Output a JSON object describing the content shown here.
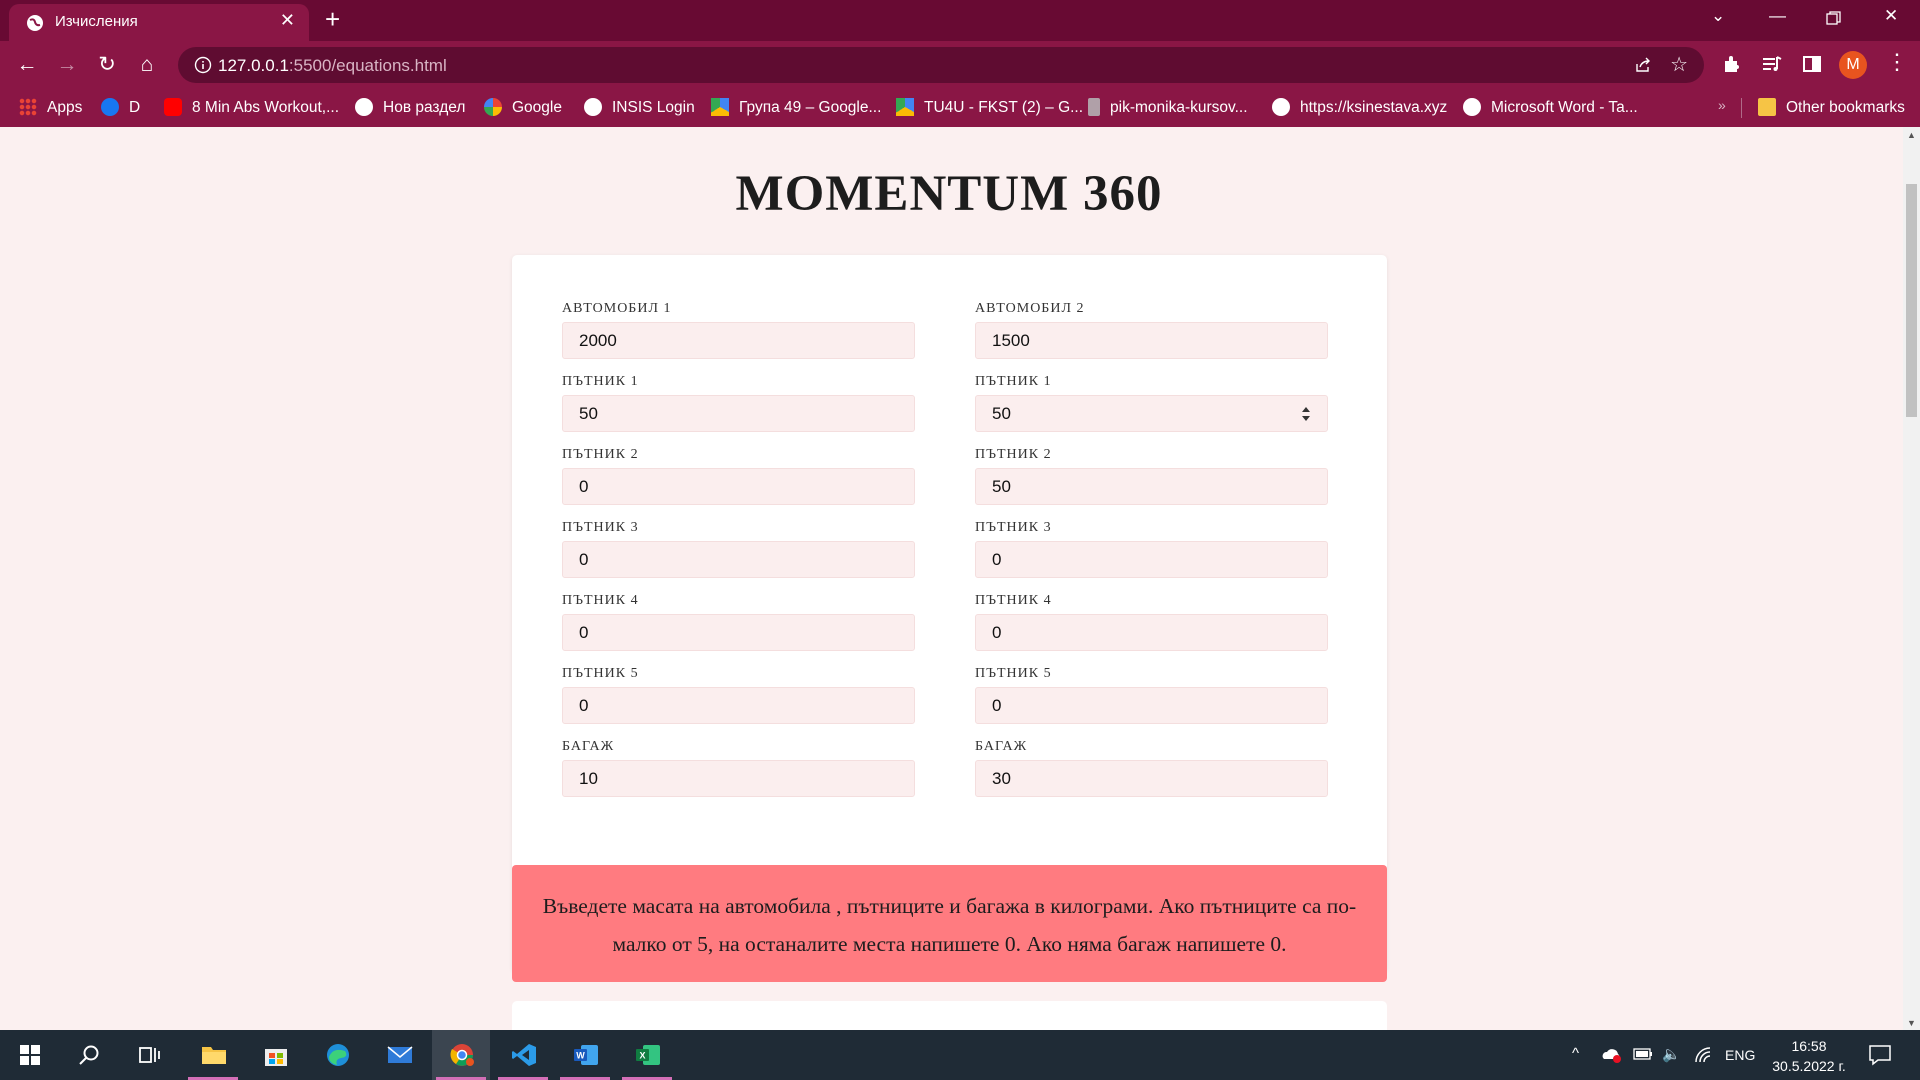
{
  "browser": {
    "tab_title": "Изчисления",
    "url_host": "127.0.0.1",
    "url_rest": ":5500/equations.html",
    "avatar_letter": "M"
  },
  "bookmarks": [
    {
      "label": "Apps",
      "icon": "apps-grid-icon",
      "color": "#e74c3c"
    },
    {
      "label": "D",
      "icon": "facebook-icon",
      "color": "#1877f2"
    },
    {
      "label": "8 Min Abs Workout,...",
      "icon": "youtube-icon",
      "color": "#ff0000"
    },
    {
      "label": "Нов раздел",
      "icon": "globe-icon",
      "color": "#ffffff"
    },
    {
      "label": "Google",
      "icon": "google-icon",
      "color": "#ffffff"
    },
    {
      "label": "INSIS Login",
      "icon": "globe-icon",
      "color": "#ffffff"
    },
    {
      "label": "Група 49 – Google...",
      "icon": "google-drive-icon",
      "color": "#f4b400"
    },
    {
      "label": "TU4U - FKST (2) – G...",
      "icon": "google-drive-icon",
      "color": "#f4b400"
    },
    {
      "label": "pik-monika-kursov...",
      "icon": "file-icon",
      "color": "#cccccc"
    },
    {
      "label": "https://ksinestava.xyz",
      "icon": "globe-icon",
      "color": "#ffffff"
    },
    {
      "label": "Microsoft Word - Ta...",
      "icon": "globe-icon",
      "color": "#ffffff"
    }
  ],
  "other_bookmarks": "Other bookmarks",
  "page": {
    "title": "MOMENTUM 360",
    "car1": {
      "fields": [
        {
          "label": "АВТОМОБИЛ 1",
          "value": "2000"
        },
        {
          "label": "ПЪТНИК 1",
          "value": "50"
        },
        {
          "label": "ПЪТНИК 2",
          "value": "0"
        },
        {
          "label": "ПЪТНИК 3",
          "value": "0"
        },
        {
          "label": "ПЪТНИК 4",
          "value": "0"
        },
        {
          "label": "ПЪТНИК 5",
          "value": "0"
        },
        {
          "label": "БАГАЖ",
          "value": "10"
        }
      ]
    },
    "car2": {
      "fields": [
        {
          "label": "АВТОМОБИЛ 2",
          "value": "1500"
        },
        {
          "label": "ПЪТНИК 1",
          "value": "50"
        },
        {
          "label": "ПЪТНИК 2",
          "value": "50"
        },
        {
          "label": "ПЪТНИК 3",
          "value": "0"
        },
        {
          "label": "ПЪТНИК 4",
          "value": "0"
        },
        {
          "label": "ПЪТНИК 5",
          "value": "0"
        },
        {
          "label": "БАГАЖ",
          "value": "30"
        }
      ]
    },
    "instructions": "Въведете масата на автомобила , пътниците и багажа в килограми. Ако пътниците са по-малко от 5, на останалите места напишете 0. Ако няма багаж напишете 0."
  },
  "taskbar": {
    "apps": [
      "start-icon",
      "search-icon",
      "task-view-icon",
      "file-explorer-icon",
      "store-icon",
      "edge-icon",
      "mail-icon",
      "chrome-icon",
      "vscode-icon",
      "word-icon",
      "excel-icon"
    ],
    "language": "ENG",
    "time": "16:58",
    "date": "30.5.2022 г."
  },
  "colors": {
    "titlebar": "#680a33",
    "toolbar": "#8a1645",
    "page_bg": "#fbf0f0",
    "input_bg": "#fbeeee",
    "info_bg": "#ff7b80"
  }
}
